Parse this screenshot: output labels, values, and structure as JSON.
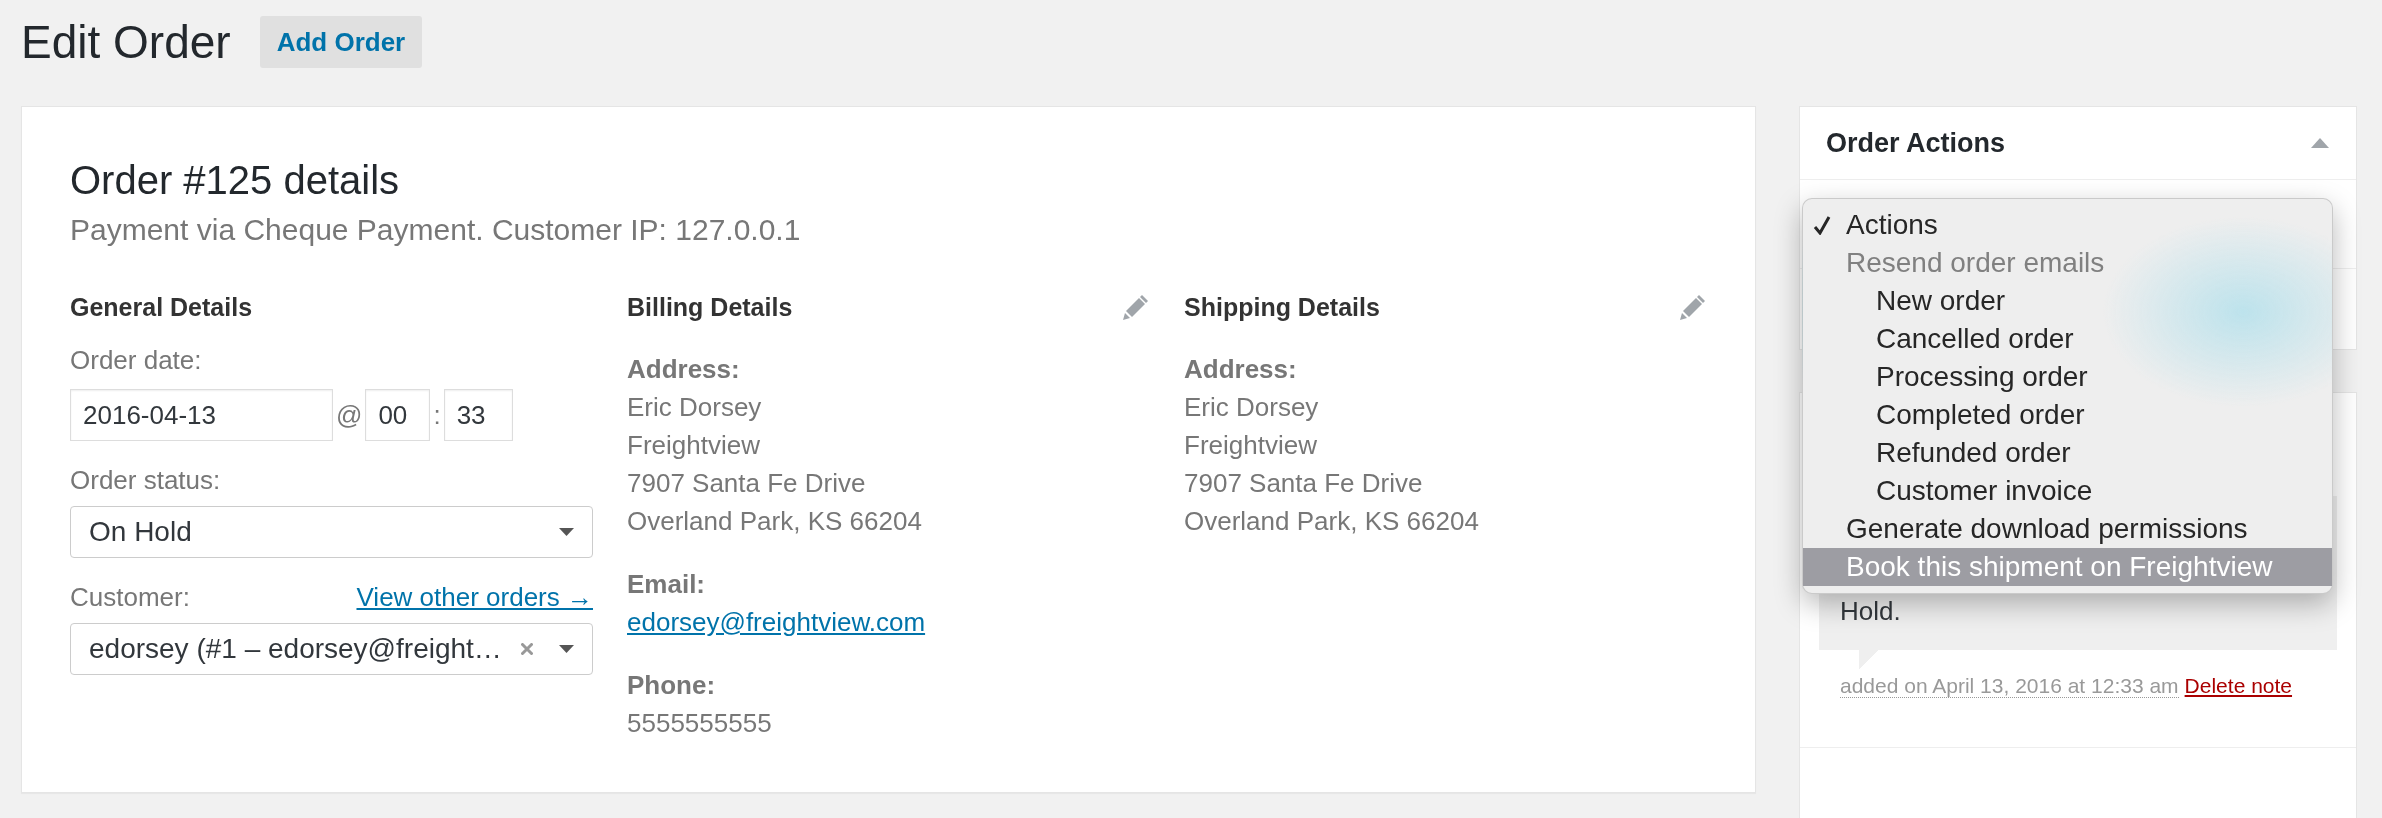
{
  "page": {
    "title": "Edit Order",
    "add_button": "Add Order"
  },
  "order": {
    "heading": "Order #125 details",
    "subtitle": "Payment via Cheque Payment. Customer IP: 127.0.0.1",
    "general": {
      "heading": "General Details",
      "date_label": "Order date:",
      "date": "2016-04-13",
      "at": "@",
      "hour": "00",
      "colon": ":",
      "minute": "33",
      "status_label": "Order status:",
      "status": "On Hold",
      "customer_label": "Customer:",
      "customer_link": "View other orders →",
      "customer": "edorsey (#1 – edorsey@freight…"
    },
    "billing": {
      "heading": "Billing Details",
      "groups": [
        {
          "label": "Address:",
          "kind": "text",
          "lines": [
            "Eric Dorsey",
            "Freightview",
            "7907 Santa Fe Drive",
            "Overland Park, KS 66204"
          ]
        },
        {
          "label": "Email:",
          "kind": "link",
          "lines": [
            "edorsey@freightview.com"
          ]
        },
        {
          "label": "Phone:",
          "kind": "text",
          "lines": [
            "5555555555"
          ]
        }
      ]
    },
    "shipping": {
      "heading": "Shipping Details",
      "groups": [
        {
          "label": "Address:",
          "kind": "text",
          "lines": [
            "Eric Dorsey",
            "Freightview",
            "7907 Santa Fe Drive",
            "Overland Park, KS 66204"
          ]
        }
      ]
    }
  },
  "order_actions": {
    "title": "Order Actions",
    "expanded": true,
    "menu": [
      {
        "label": "Actions",
        "kind": "option",
        "selected": true,
        "highlighted": false
      },
      {
        "label": "Resend order emails",
        "kind": "group",
        "children": [
          {
            "label": "New order",
            "selected": false,
            "highlighted": false
          },
          {
            "label": "Cancelled order",
            "selected": false,
            "highlighted": false
          },
          {
            "label": "Processing order",
            "selected": false,
            "highlighted": false
          },
          {
            "label": "Completed order",
            "selected": false,
            "highlighted": false
          },
          {
            "label": "Refunded order",
            "selected": false,
            "highlighted": false
          },
          {
            "label": "Customer invoice",
            "selected": false,
            "highlighted": false
          }
        ]
      },
      {
        "label": "Generate download permissions",
        "kind": "option",
        "selected": false,
        "highlighted": false
      },
      {
        "label": "Book this shipment on Freightview",
        "kind": "option",
        "selected": false,
        "highlighted": true
      }
    ]
  },
  "notes": [
    {
      "text": "Hold.",
      "meta": "added on April 13, 2016 at 12:33 am",
      "delete_link": "Delete note"
    }
  ]
}
